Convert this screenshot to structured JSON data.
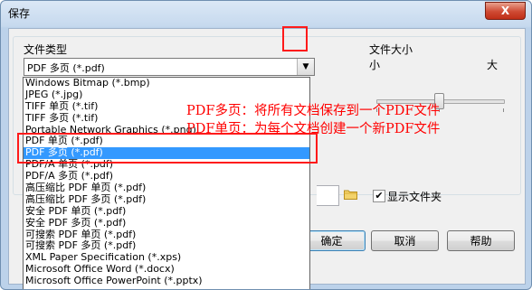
{
  "window": {
    "title": "保存",
    "close_label": "X"
  },
  "file_type": {
    "label": "文件类型",
    "selected": "PDF 多页 (*.pdf)",
    "options": [
      "Windows Bitmap (*.bmp)",
      "JPEG (*.jpg)",
      "TIFF 单页 (*.tif)",
      "TIFF 多页 (*.tif)",
      "Portable Network Graphics (*.png)",
      "PDF 单页 (*.pdf)",
      "PDF 多页 (*.pdf)",
      "PDF/A 单页 (*.pdf)",
      "PDF/A 多页 (*.pdf)",
      "高压缩比 PDF 单页 (*.pdf)",
      "高压缩比 PDF 多页 (*.pdf)",
      "安全 PDF 单页 (*.pdf)",
      "安全 PDF 多页 (*.pdf)",
      "可搜索 PDF 单页 (*.pdf)",
      "可搜索 PDF 多页 (*.pdf)",
      "XML Paper Specification (*.xps)",
      "Microsoft Office Word (*.docx)",
      "Microsoft Office PowerPoint (*.pptx)"
    ],
    "highlighted_index": 6
  },
  "file_size": {
    "label": "文件大小",
    "min_label": "小",
    "max_label": "大",
    "level": 0.45
  },
  "show_folder": {
    "label": "显示文件夹",
    "checked": true
  },
  "buttons": {
    "ok": "确定",
    "cancel": "取消",
    "help": "帮助"
  },
  "annotations": {
    "line1": "PDF多页：将所有文档保存到一个PDF文件",
    "line2": "PDF单页：为每个文档创建一个新PDF文件"
  },
  "colors": {
    "accent": "#3399ff",
    "annotation": "#ff0000",
    "close_button": "#c9432c"
  }
}
